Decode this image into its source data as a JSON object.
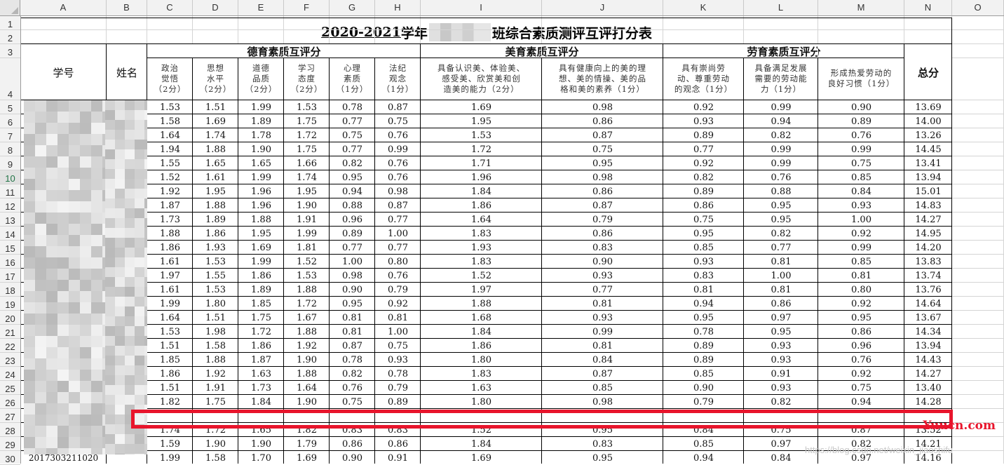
{
  "columns": [
    "A",
    "B",
    "C",
    "D",
    "E",
    "F",
    "G",
    "H",
    "I",
    "J",
    "K",
    "L",
    "M",
    "N",
    "O"
  ],
  "rows": [
    "1",
    "2",
    "3",
    "4",
    "5",
    "6",
    "7",
    "8",
    "9",
    "10",
    "11",
    "12",
    "13",
    "14",
    "15",
    "16",
    "17",
    "18",
    "19",
    "20",
    "21",
    "22",
    "23",
    "24",
    "25",
    "26",
    "27",
    "28",
    "29",
    "30"
  ],
  "selected_row": "10",
  "sheet": {
    "title_year": "2020-2021",
    "title_mid": "学年",
    "title_rest": "班综合素质测评互评打分表",
    "header_xuehao": "学号",
    "header_xingming": "姓名",
    "group_deyu": "德育素质互评分",
    "group_meiyu": "美育素质互评分",
    "group_laoyu": "劳育素质互评分",
    "header_total": "总分",
    "sub_c": "政治\n觉悟\n（2分）",
    "sub_d": "思想\n水平\n（2分）",
    "sub_e": "道德\n品质\n（2分）",
    "sub_f": "学习\n态度\n（2分）",
    "sub_g": "心理\n素质\n（1分）",
    "sub_h": "法纪\n观念\n（1分）",
    "sub_i": "具备认识美、体验美、\n感受美、欣赏美和创\n造美的能力（2分）",
    "sub_j": "具有健康向上的美的理\n想、美的情操、美的品\n格和美的素养（1分）",
    "sub_k": "具有崇尚劳\n动、尊重劳动\n的观念（1分）",
    "sub_l": "具备满足发展\n需要的劳动能\n力（1分）",
    "sub_m": "形成热爱劳动的\n良好习惯（1分）",
    "visible_id_row30": "2017303211020"
  },
  "data_rows": [
    [
      "1.53",
      "1.51",
      "1.99",
      "1.53",
      "0.78",
      "0.87",
      "1.69",
      "0.98",
      "0.92",
      "0.99",
      "0.90",
      "13.69"
    ],
    [
      "1.58",
      "1.69",
      "1.89",
      "1.75",
      "0.77",
      "0.75",
      "1.95",
      "0.86",
      "0.93",
      "0.94",
      "0.89",
      "14.00"
    ],
    [
      "1.64",
      "1.74",
      "1.78",
      "1.72",
      "0.75",
      "0.76",
      "1.53",
      "0.87",
      "0.89",
      "0.82",
      "0.76",
      "13.26"
    ],
    [
      "1.94",
      "1.88",
      "1.90",
      "1.75",
      "0.77",
      "0.99",
      "1.72",
      "0.75",
      "0.77",
      "0.99",
      "0.99",
      "14.45"
    ],
    [
      "1.55",
      "1.65",
      "1.65",
      "1.66",
      "0.82",
      "0.76",
      "1.71",
      "0.95",
      "0.92",
      "0.99",
      "0.75",
      "13.41"
    ],
    [
      "1.52",
      "1.61",
      "1.99",
      "1.74",
      "0.95",
      "0.76",
      "1.96",
      "0.98",
      "0.82",
      "0.76",
      "0.85",
      "13.94"
    ],
    [
      "1.92",
      "1.95",
      "1.96",
      "1.95",
      "0.94",
      "0.98",
      "1.84",
      "0.86",
      "0.89",
      "0.88",
      "0.84",
      "15.01"
    ],
    [
      "1.87",
      "1.88",
      "1.96",
      "1.90",
      "0.88",
      "0.87",
      "1.86",
      "0.87",
      "0.86",
      "0.95",
      "0.93",
      "14.83"
    ],
    [
      "1.73",
      "1.89",
      "1.88",
      "1.91",
      "0.96",
      "0.77",
      "1.64",
      "0.79",
      "0.75",
      "0.95",
      "1.00",
      "14.27"
    ],
    [
      "1.88",
      "1.86",
      "1.95",
      "1.99",
      "0.89",
      "1.00",
      "1.83",
      "0.86",
      "0.95",
      "0.82",
      "0.92",
      "14.95"
    ],
    [
      "1.86",
      "1.93",
      "1.69",
      "1.81",
      "0.77",
      "0.77",
      "1.93",
      "0.83",
      "0.85",
      "0.77",
      "0.99",
      "14.20"
    ],
    [
      "1.61",
      "1.53",
      "1.99",
      "1.52",
      "1.00",
      "0.80",
      "1.83",
      "0.90",
      "0.93",
      "0.81",
      "0.85",
      "13.83"
    ],
    [
      "1.97",
      "1.55",
      "1.86",
      "1.53",
      "0.98",
      "0.76",
      "1.52",
      "0.93",
      "0.83",
      "1.00",
      "0.81",
      "13.74"
    ],
    [
      "1.61",
      "1.53",
      "1.89",
      "1.88",
      "0.90",
      "0.79",
      "1.97",
      "0.77",
      "0.81",
      "0.81",
      "0.80",
      "13.76"
    ],
    [
      "1.99",
      "1.80",
      "1.85",
      "1.72",
      "0.95",
      "0.92",
      "1.88",
      "0.81",
      "0.94",
      "0.86",
      "0.92",
      "14.64"
    ],
    [
      "1.64",
      "1.51",
      "1.75",
      "1.67",
      "0.81",
      "0.81",
      "1.68",
      "0.93",
      "0.95",
      "0.97",
      "0.95",
      "13.67"
    ],
    [
      "1.53",
      "1.98",
      "1.72",
      "1.88",
      "0.81",
      "1.00",
      "1.84",
      "0.99",
      "0.78",
      "0.95",
      "0.86",
      "14.34"
    ],
    [
      "1.51",
      "1.58",
      "1.86",
      "1.92",
      "0.87",
      "0.75",
      "1.86",
      "0.81",
      "0.89",
      "0.93",
      "0.96",
      "13.94"
    ],
    [
      "1.85",
      "1.88",
      "1.87",
      "1.90",
      "0.78",
      "0.93",
      "1.80",
      "0.84",
      "0.89",
      "0.93",
      "0.76",
      "14.43"
    ],
    [
      "1.86",
      "1.92",
      "1.63",
      "1.88",
      "0.82",
      "0.78",
      "1.83",
      "0.87",
      "0.85",
      "0.91",
      "0.92",
      "14.27"
    ],
    [
      "1.51",
      "1.91",
      "1.73",
      "1.64",
      "0.76",
      "0.79",
      "1.63",
      "0.85",
      "0.90",
      "0.93",
      "0.75",
      "13.40"
    ],
    [
      "1.82",
      "1.75",
      "1.84",
      "1.90",
      "0.75",
      "0.89",
      "1.80",
      "0.98",
      "0.79",
      "0.82",
      "0.94",
      "14.28"
    ],
    [
      "",
      "",
      "",
      "",
      "",
      "",
      "",
      "",
      "",
      "",
      "",
      ""
    ],
    [
      "1.74",
      "1.72",
      "1.65",
      "1.82",
      "0.83",
      "0.83",
      "1.52",
      "0.95",
      "0.84",
      "0.75",
      "0.87",
      "13.52"
    ],
    [
      "1.59",
      "1.90",
      "1.90",
      "1.79",
      "0.86",
      "0.86",
      "1.84",
      "0.83",
      "0.85",
      "0.97",
      "0.82",
      "14.21"
    ],
    [
      "1.99",
      "1.58",
      "1.70",
      "1.69",
      "0.90",
      "0.91",
      "1.69",
      "0.95",
      "0.94",
      "0.84",
      "0.97",
      "14.16"
    ]
  ],
  "watermark_brand": "Yuucn.com",
  "watermark_url": "https://blog.csdn.net/weixin_jiaoshifu",
  "accent_red": "#e8152c",
  "excel_green": "#217346"
}
